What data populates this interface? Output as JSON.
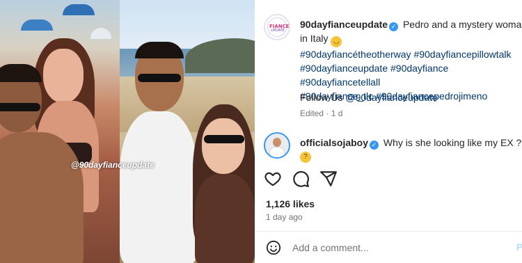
{
  "photo": {
    "watermark": "@90dayfianceupdate"
  },
  "post": {
    "author": "90dayfianceupdate",
    "avatar_logo_top": "FIANCE",
    "avatar_logo_bottom": "UPDATE",
    "caption_text": "Pedro and a mystery woman in Italy",
    "caption_emoji": "😆",
    "hashtags": [
      "#90dayfiancétheotherway",
      "#90dayfiancepillowtalk",
      "#90dayfianceupdate",
      "#90dayfiance",
      "#90dayfiancetellall",
      "#90dayfiance_tlc",
      "#90dayfiancepedrojimeno"
    ],
    "follow_prefix": "Follow Us",
    "follow_handle": "@90dayfianceupdate",
    "meta": "Edited · 1 d"
  },
  "comment": {
    "author": "officialsojaboy",
    "text": "Why is she looking like my EX ?",
    "emoji": "🤔"
  },
  "actions": {
    "icons": [
      "heart-icon",
      "comment-icon",
      "share-icon"
    ]
  },
  "likes": "1,126 likes",
  "time_ago": "1 day ago",
  "add_comment": {
    "placeholder": "Add a comment...",
    "post_label": "P"
  },
  "colors": {
    "link": "#00376b",
    "verified": "#3897f0",
    "muted": "#737373",
    "text": "#262626"
  }
}
